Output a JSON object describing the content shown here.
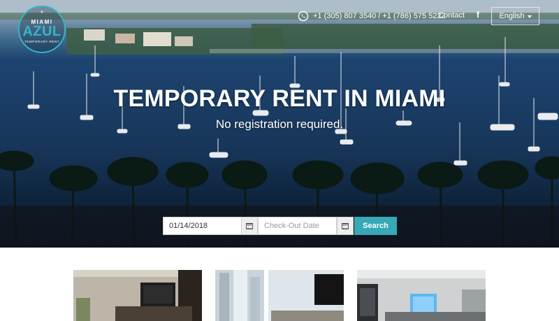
{
  "logo": {
    "line1": "MIAMI",
    "line2": "AZUL",
    "line3": "TEMPORARY RENT"
  },
  "header": {
    "phone": "+1 (305) 807 3540 / +1 (786) 575 5222",
    "contact": "Contact",
    "facebook_glyph": "f",
    "language": "English"
  },
  "hero": {
    "title": "TEMPORARY RENT IN MIAMI",
    "subtitle": "No registration required."
  },
  "search": {
    "checkin_value": "01/14/2018",
    "checkout_placeholder": "Check-Out Date",
    "button_label": "Search"
  },
  "icons": {
    "phone": "whatsapp-icon",
    "social": "facebook-icon",
    "calendar": "calendar-icon",
    "dropdown": "caret-down-icon"
  },
  "colors": {
    "accent": "#37a8b8",
    "logo_teal": "#37b4c7"
  }
}
